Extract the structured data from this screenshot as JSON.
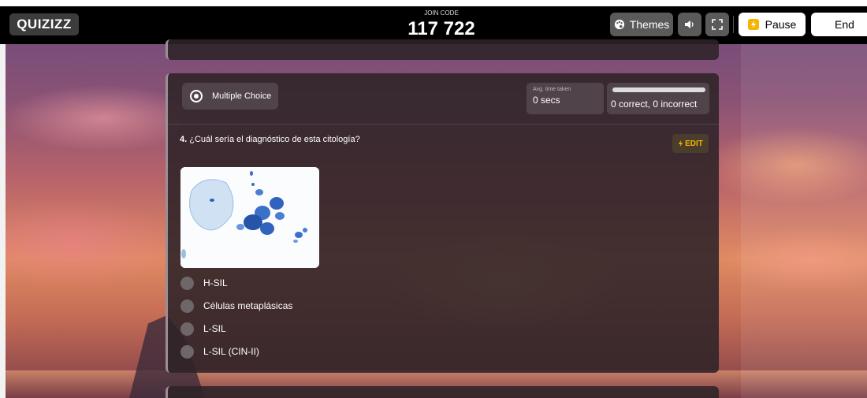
{
  "header": {
    "logo_text": "QUIZIZZ",
    "join_label": "JOIN CODE",
    "join_code": "117 722",
    "themes_label": "Themes",
    "pause_label": "Pause",
    "end_label": "End",
    "icons": [
      "palette-icon",
      "speaker-icon",
      "fullscreen-icon",
      "pause-icon"
    ]
  },
  "question_card": {
    "type_label": "Multiple Choice",
    "avg_time_label": "Avg. time taken",
    "avg_time_value": "0 secs",
    "accuracy_text": "0 correct, 0 incorrect",
    "question_number": "4.",
    "question_text": "¿Cuál sería el diagnóstico de esta citología?",
    "edit_label": "EDIT",
    "options": [
      "H-SIL",
      "Células metaplásicas",
      "L-SIL",
      "L-SIL (CIN-II)"
    ]
  },
  "colors": {
    "accent_yellow": "#f4b400",
    "card_bg": "#2d2328",
    "option_dot": "#6e6669"
  }
}
